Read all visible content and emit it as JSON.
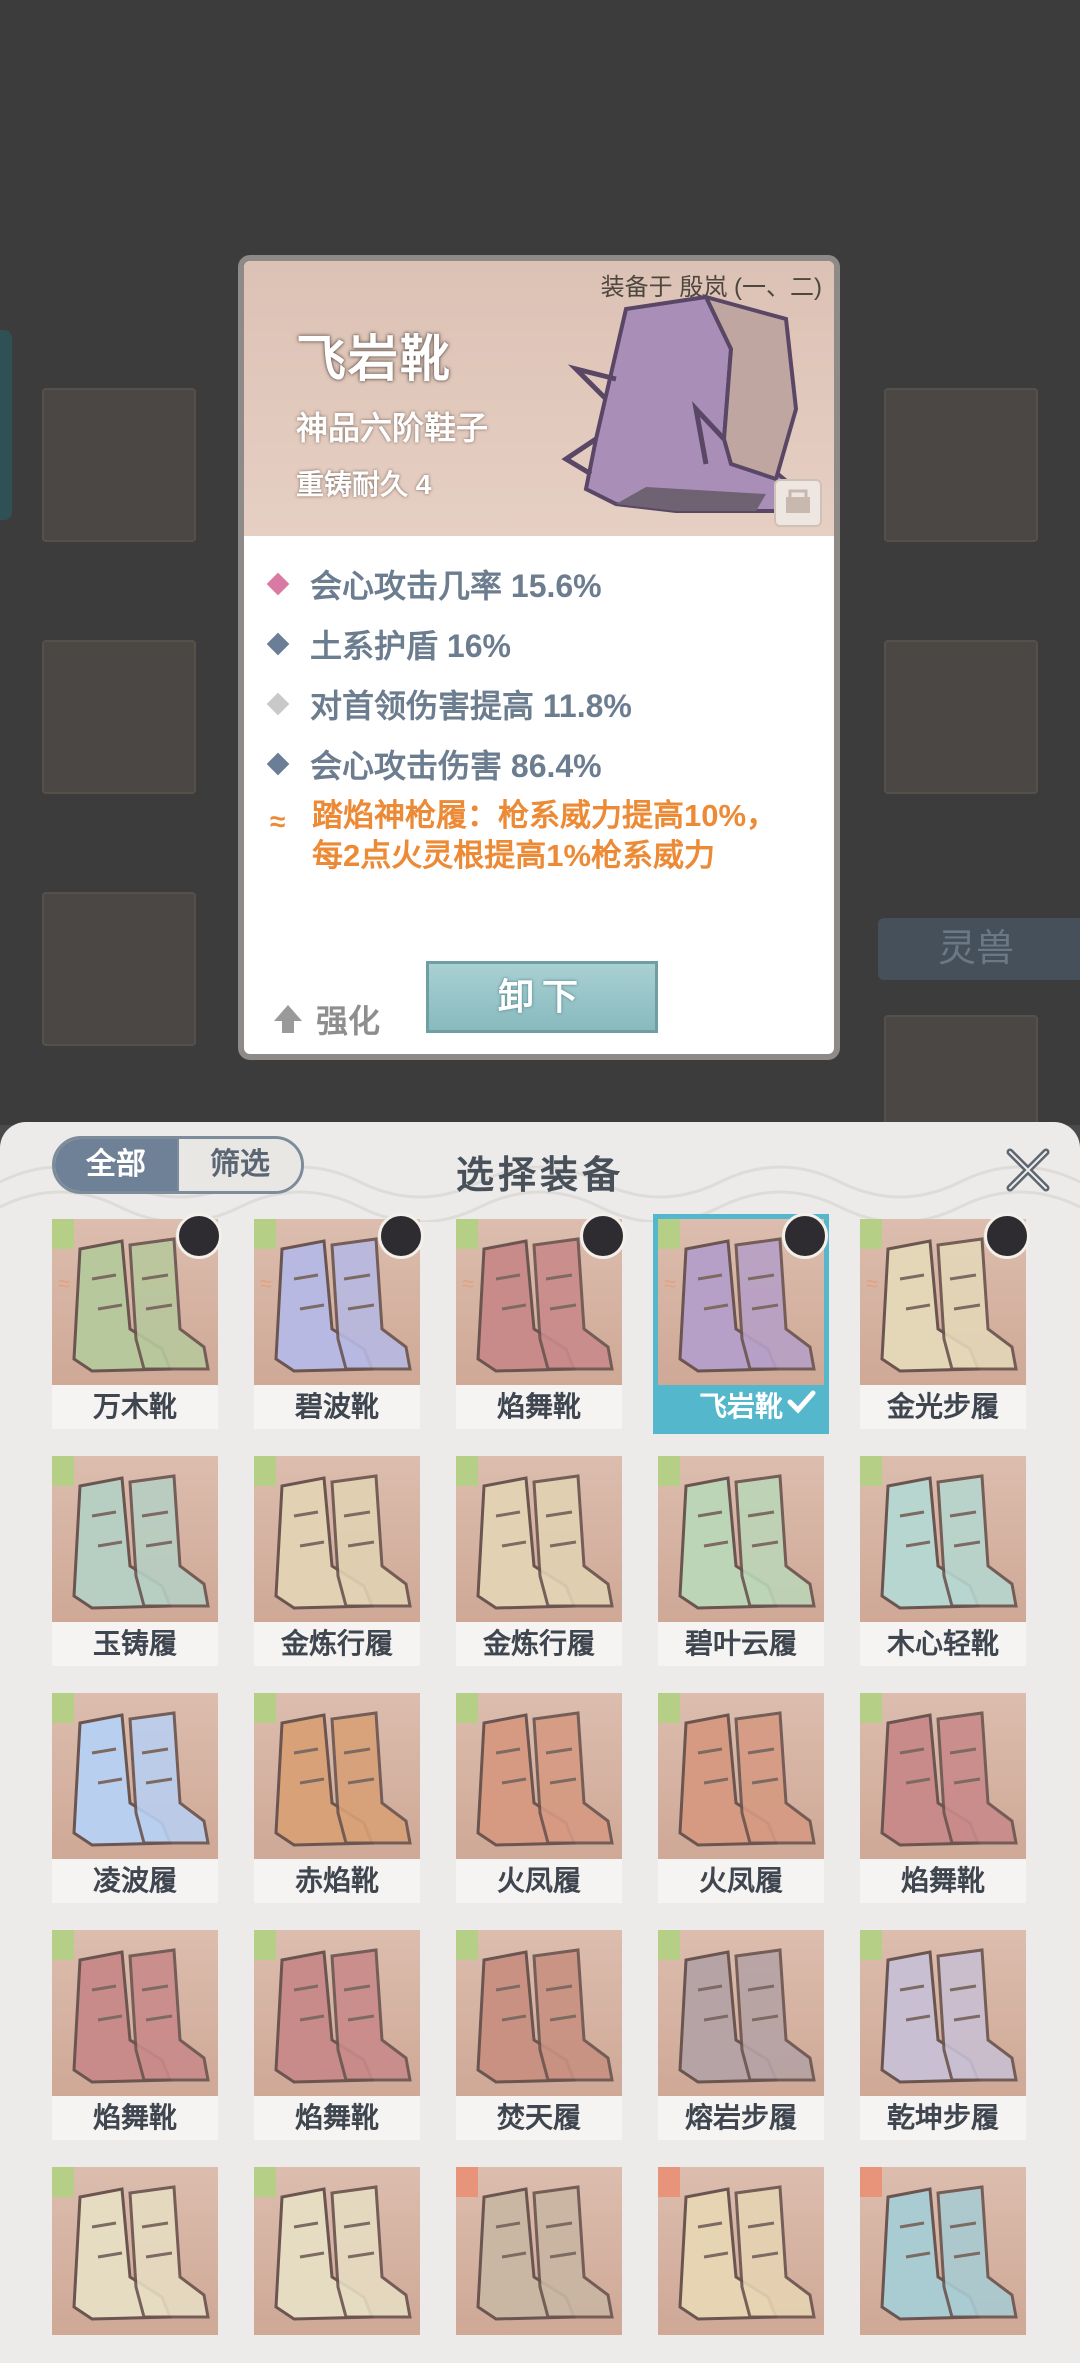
{
  "detail": {
    "equipped_to": "装备于 殷岚 (一、二)",
    "name": "飞岩靴",
    "grade": "神品六阶鞋子",
    "durability": "重铸耐久 4",
    "stats": [
      {
        "text": "会心攻击几率 15.6%",
        "color": "#d97aa3"
      },
      {
        "text": "土系护盾 16%",
        "color": "#6a7f96"
      },
      {
        "text": "对首领伤害提高 11.8%",
        "color": "#c9c9c9"
      },
      {
        "text": "会心攻击伤害 86.4%",
        "color": "#6a7f96"
      }
    ],
    "set_bonus_line1": "踏焰神枪履：枪系威力提高10%，",
    "set_bonus_line2": "每2点火灵根提高1%枪系威力",
    "upgrade_label": "强化",
    "unequip_label": "卸下"
  },
  "background": {
    "tag_label": "灵兽"
  },
  "sheet": {
    "title": "选择装备",
    "tab_all": "全部",
    "tab_filter": "筛选"
  },
  "items": [
    {
      "name": "万木靴",
      "tint": "#b8c89d",
      "avatar": true,
      "set": true,
      "tag": "#b6cf87"
    },
    {
      "name": "碧波靴",
      "tint": "#b7b9e2",
      "avatar": true,
      "set": true,
      "tag": "#b6cf87"
    },
    {
      "name": "焰舞靴",
      "tint": "#c98a8a",
      "avatar": true,
      "set": true,
      "tag": "#b6cf87"
    },
    {
      "name": "飞岩靴",
      "tint": "#b7a0c7",
      "avatar": true,
      "set": true,
      "tag": "#b6cf87",
      "selected": true
    },
    {
      "name": "金光步履",
      "tint": "#e4d7b8",
      "avatar": true,
      "set": true,
      "tag": "#b6cf87"
    },
    {
      "name": "玉铸履",
      "tint": "#b7cfc2",
      "tag": "#b6cf87"
    },
    {
      "name": "金炼行履",
      "tint": "#e2d2b3",
      "tag": "#b6cf87"
    },
    {
      "name": "金炼行履",
      "tint": "#e2d2b3",
      "tag": "#b6cf87"
    },
    {
      "name": "碧叶云履",
      "tint": "#bcd5b7",
      "tag": "#b6cf87"
    },
    {
      "name": "木心轻靴",
      "tint": "#b6d6cf",
      "tag": "#b6cf87"
    },
    {
      "name": "凌波履",
      "tint": "#b9cff0",
      "tag": "#b6cf87"
    },
    {
      "name": "赤焰靴",
      "tint": "#d8a177",
      "tag": "#b6cf87"
    },
    {
      "name": "火凤履",
      "tint": "#d69a82",
      "tag": "#b6cf87"
    },
    {
      "name": "火凤履",
      "tint": "#d69a82",
      "tag": "#b6cf87"
    },
    {
      "name": "焰舞靴",
      "tint": "#c98a8a",
      "tag": "#b6cf87"
    },
    {
      "name": "焰舞靴",
      "tint": "#c98a8a",
      "tag": "#b6cf87"
    },
    {
      "name": "焰舞靴",
      "tint": "#c98a8a",
      "tag": "#b6cf87"
    },
    {
      "name": "焚天履",
      "tint": "#c99182",
      "tag": "#b6cf87"
    },
    {
      "name": "熔岩步履",
      "tint": "#b6a3a5",
      "tag": "#b6cf87"
    },
    {
      "name": "乾坤步履",
      "tint": "#c9bfd2",
      "tag": "#b6cf87"
    },
    {
      "name": "",
      "tint": "#e6dcc2",
      "tag": "#b6cf87"
    },
    {
      "name": "",
      "tint": "#e6dcc2",
      "tag": "#b6cf87"
    },
    {
      "name": "",
      "tint": "#c9b6a3",
      "tag": "#e8947a"
    },
    {
      "name": "",
      "tint": "#e6d4b3",
      "tag": "#e8947a"
    },
    {
      "name": "",
      "tint": "#a9cbd2",
      "tag": "#e8947a"
    }
  ]
}
